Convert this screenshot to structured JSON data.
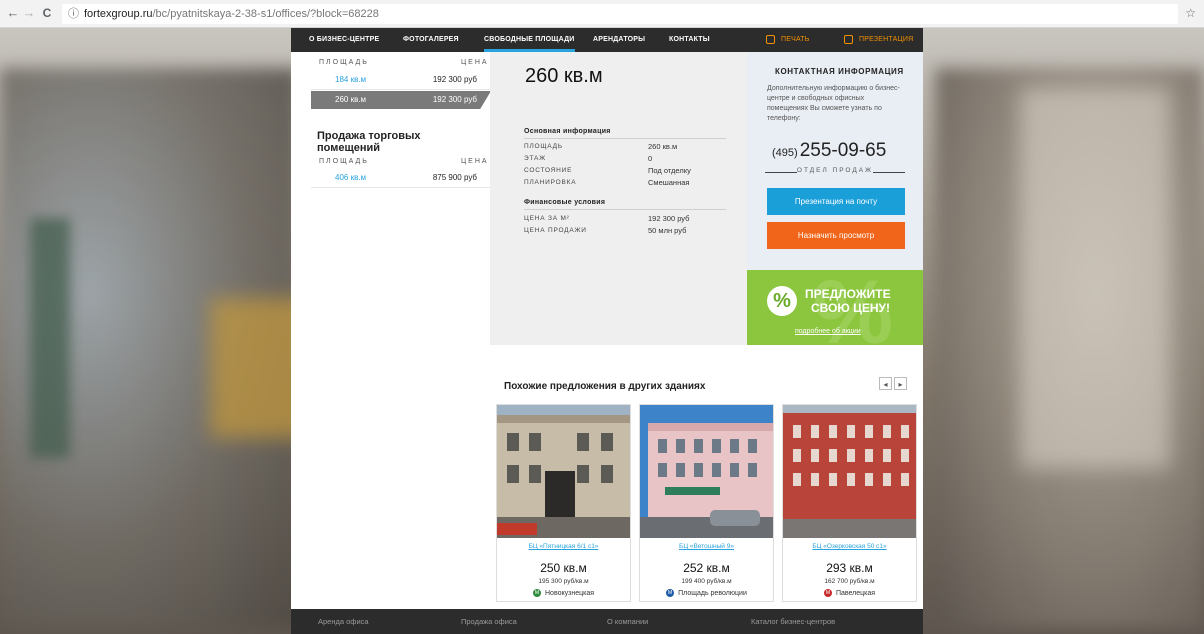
{
  "browser": {
    "url_host": "fortexgroup.ru",
    "url_path": "/bc/pyatnitskaya-2-38-s1/offices/?block=68228",
    "back": "←",
    "forward": "→",
    "reload": "C",
    "info": "ⓘ",
    "bookmark": "☆"
  },
  "nav": {
    "items": [
      "О БИЗНЕС-ЦЕНТРЕ",
      "ФОТОГАЛЕРЕЯ",
      "СВОБОДНЫЕ ПЛОЩАДИ",
      "АРЕНДАТОРЫ",
      "КОНТАКТЫ"
    ],
    "print": "ПЕЧАТЬ",
    "presentation": "ПРЕЗЕНТАЦИЯ",
    "active_index": 2
  },
  "rent_table": {
    "col_area": "ПЛОЩАДЬ",
    "col_price": "ЦЕНА",
    "rows": [
      {
        "area": "184 кв.м",
        "price": "192 300 руб"
      },
      {
        "area": "260 кв.м",
        "price": "192 300 руб"
      }
    ]
  },
  "sale": {
    "title": "Продажа торговых помещений",
    "col_area": "ПЛОЩАДЬ",
    "col_price": "ЦЕНА",
    "rows": [
      {
        "area": "406 кв.м",
        "price": "875 900 руб"
      }
    ]
  },
  "detail": {
    "area": "260 кв.м",
    "basic_title": "Основная информация",
    "basic": [
      {
        "k": "ПЛОЩАДЬ",
        "v": "260 кв.м"
      },
      {
        "k": "ЭТАЖ",
        "v": "0"
      },
      {
        "k": "СОСТОЯНИЕ",
        "v": "Под отделку"
      },
      {
        "k": "ПЛАНИРОВКА",
        "v": "Смешанная"
      }
    ],
    "finance_title": "Финансовые условия",
    "finance": [
      {
        "k": "ЦЕНА ЗА М²",
        "v": "192 300 руб"
      },
      {
        "k": "ЦЕНА ПРОДАЖИ",
        "v": "50 млн руб"
      }
    ]
  },
  "contact": {
    "title": "КОНТАКТНАЯ ИНФОРМАЦИЯ",
    "desc": "Дополнительную информацию о бизнес-центре и свободных офисных помещениях Вы сможете узнать по телефону:",
    "phone_code": "(495)",
    "phone_number": "255-09-65",
    "dept": "ОТДЕЛ ПРОДАЖ",
    "btn_presentation": "Презентация на почту",
    "btn_view": "Назначить просмотр"
  },
  "promo": {
    "pct": "%",
    "line1": "ПРЕДЛОЖИТЕ",
    "line2": "СВОЮ ЦЕНУ!",
    "more": "подробнее об акции"
  },
  "similar": {
    "title": "Похожие предложения в других зданиях",
    "prev": "◂",
    "next": "▸",
    "cards": [
      {
        "name": "БЦ «Пятницкая 6/1 с1»",
        "area": "250 кв.м",
        "price": "195 300 руб/кв.м",
        "metro": "Новокузнецкая",
        "metro_color": "#2e8b3c",
        "metro_letter": "M"
      },
      {
        "name": "БЦ «Ветошный 9»",
        "area": "252 кв.м",
        "price": "199 400 руб/кв.м",
        "metro": "Площадь революции",
        "metro_color": "#1f5aa6",
        "metro_letter": "M"
      },
      {
        "name": "БЦ «Озерковская 50 с1»",
        "area": "293 кв.м",
        "price": "162 700 руб/кв.м",
        "metro": "Павелецкая",
        "metro_color": "#c62828",
        "metro_letter": "M"
      }
    ]
  },
  "footer": {
    "links": [
      "Аренда офиса",
      "Продажа офиса",
      "О компании",
      "Каталог бизнес-центров"
    ]
  }
}
